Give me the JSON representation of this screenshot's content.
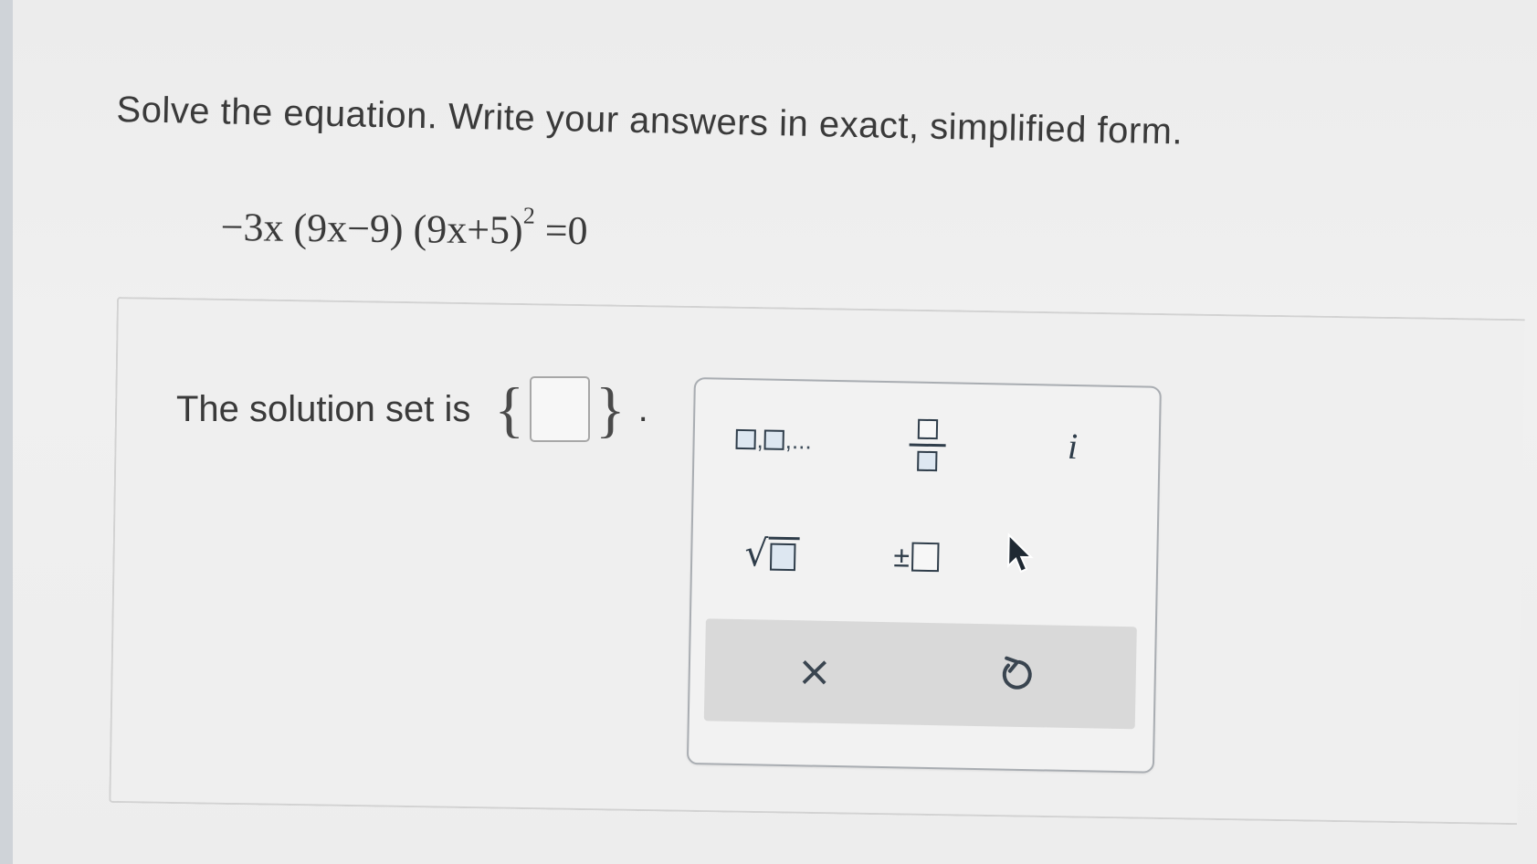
{
  "question": {
    "prompt": "Solve the equation. Write your answers in exact, simplified form.",
    "equation_main": "−3x (9x−9) (9x+5)",
    "equation_exponent": "2",
    "equation_rhs": " =0"
  },
  "answer": {
    "label": "The solution set is",
    "open_brace": "{",
    "close_brace": "}",
    "period": ".",
    "input_value": ""
  },
  "palette": {
    "buttons": [
      {
        "name": "list",
        "sep1": ",",
        "trail": ",..."
      },
      {
        "name": "fraction"
      },
      {
        "name": "imaginary",
        "label": "i"
      },
      {
        "name": "square-root",
        "radical": "√"
      },
      {
        "name": "plus-minus",
        "label": "±"
      }
    ],
    "clear_label": "×",
    "icons": [
      "list-icon",
      "fraction-icon",
      "imaginary-unit-icon",
      "square-root-icon",
      "plus-minus-icon",
      "mouse-cursor-icon",
      "clear-icon",
      "undo-icon"
    ],
    "accent_color": "#2f3d4a"
  }
}
